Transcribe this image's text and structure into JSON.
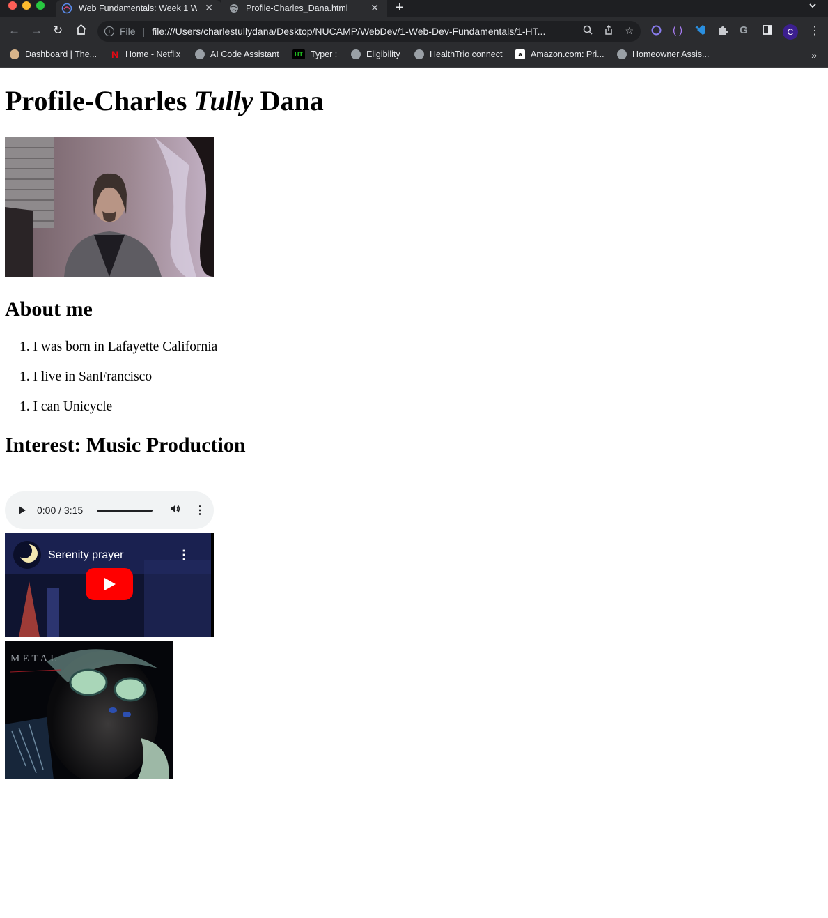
{
  "browser": {
    "tabs": [
      {
        "title": "Web Fundamentals: Week 1 W",
        "active": false
      },
      {
        "title": "Profile-Charles_Dana.html",
        "active": true
      }
    ],
    "omnibox": {
      "scheme": "File",
      "url": "file:///Users/charlestullydana/Desktop/NUCAMP/WebDev/1-Web-Dev-Fundamentals/1-HT..."
    },
    "profile_initial": "C",
    "bookmarks": [
      {
        "label": "Dashboard | The...",
        "icon": "fox-icon"
      },
      {
        "label": "Home - Netflix",
        "icon": "netflix-icon"
      },
      {
        "label": "AI Code Assistant",
        "icon": "globe-icon"
      },
      {
        "label": "Typer :",
        "icon": "typer-icon"
      },
      {
        "label": "Eligibility",
        "icon": "globe-icon"
      },
      {
        "label": "HealthTrio connect",
        "icon": "globe-icon"
      },
      {
        "label": "Amazon.com: Pri...",
        "icon": "amazon-icon"
      },
      {
        "label": "Homeowner Assis...",
        "icon": "globe-icon"
      }
    ],
    "bookmarks_overflow": "»"
  },
  "page": {
    "title_part1": "Profile-Charles ",
    "title_italic": "Tully",
    "title_part2": " Dana",
    "about_heading": "About me",
    "about_items": [
      {
        "number": "1.",
        "text": "I was born in Lafayette California"
      },
      {
        "number": "1.",
        "text": "I live in SanFrancisco"
      },
      {
        "number": "1.",
        "text": "I can Unicycle"
      }
    ],
    "interest_heading": "Interest: Music Production",
    "audio": {
      "time": "0:00 / 3:15"
    },
    "video": {
      "title": "Serenity prayer"
    },
    "album": {
      "label": "METAL"
    }
  }
}
